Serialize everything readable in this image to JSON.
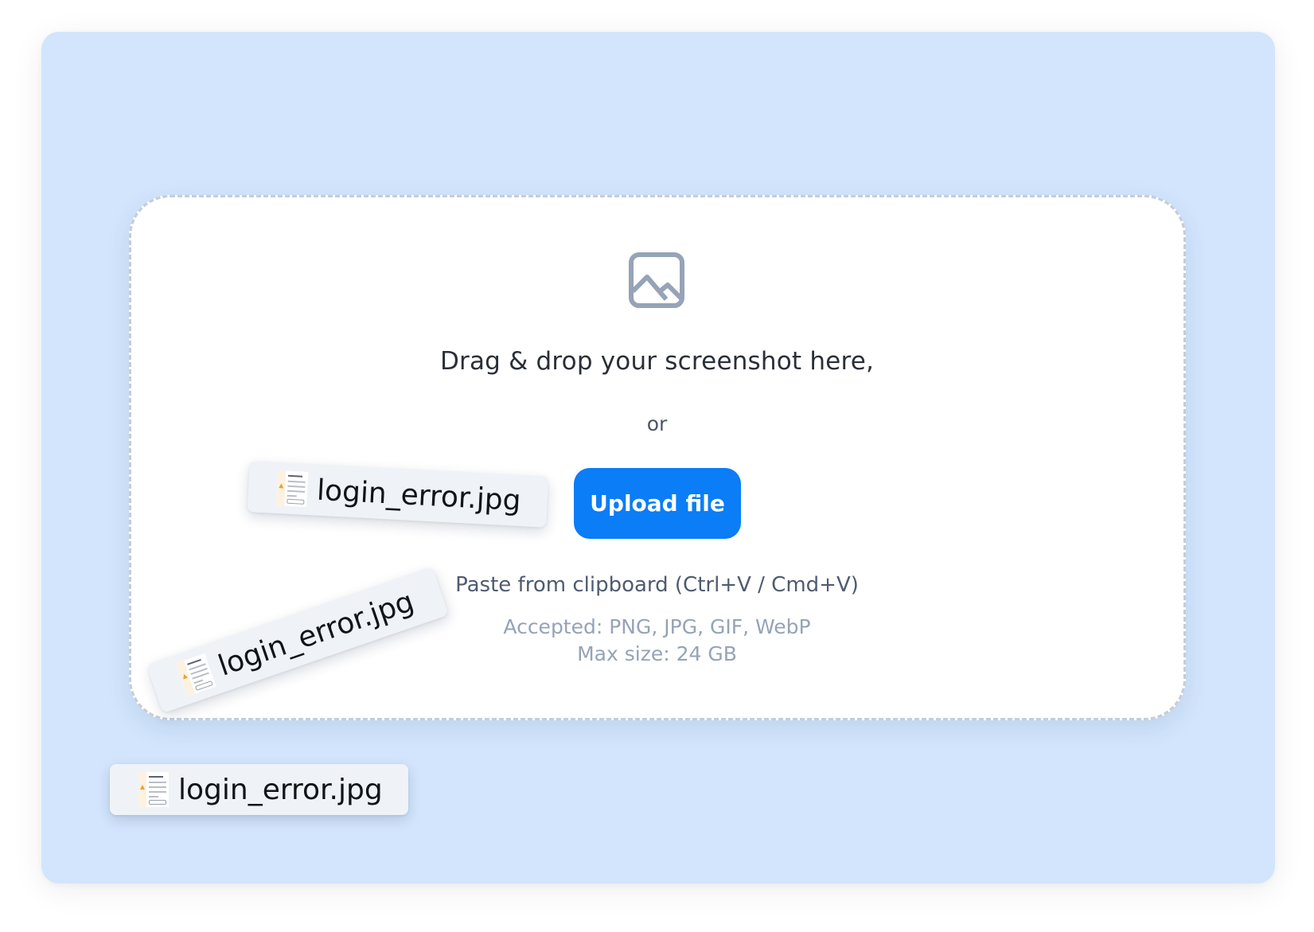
{
  "dropzone": {
    "icon": "image-icon",
    "headline": "Drag & drop your screenshot here,",
    "or_text": "or",
    "upload_button": "Upload file",
    "paste_hint": "Paste from clipboard (Ctrl+V / Cmd+V)",
    "accepted": "Accepted: PNG, JPG, GIF, WebP",
    "max_size": "Max size: 24 GB"
  },
  "dragged_files": [
    {
      "name": "login_error.jpg",
      "icon": "file-thumbnail-icon"
    },
    {
      "name": "login_error.jpg",
      "icon": "file-thumbnail-icon"
    },
    {
      "name": "login_error.jpg",
      "icon": "file-thumbnail-icon"
    }
  ],
  "colors": {
    "background": "#d2e5fc",
    "accent": "#0a7df7",
    "dropzone_border": "#c6cdd8"
  }
}
